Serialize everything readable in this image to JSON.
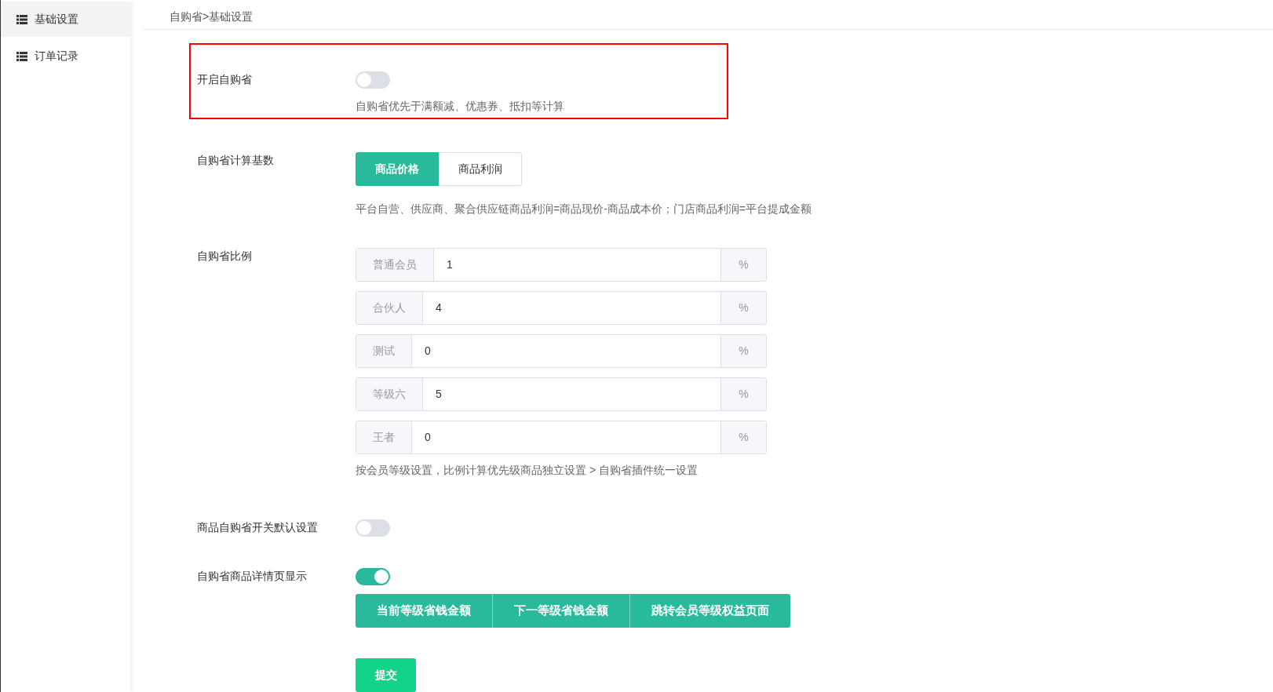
{
  "sidebar": {
    "items": [
      {
        "label": "基础设置",
        "selected": true
      },
      {
        "label": "订单记录",
        "selected": false
      }
    ]
  },
  "breadcrumb": "自购省>基础设置",
  "enable": {
    "label": "开启自购省",
    "on": false,
    "highlighted": true,
    "hint": "自购省优先于满额减、优惠券、抵扣等计算"
  },
  "base": {
    "label": "自购省计算基数",
    "options": [
      {
        "label": "商品价格",
        "selected": true
      },
      {
        "label": "商品利润",
        "selected": false
      }
    ],
    "hint": "平台自营、供应商、聚合供应链商品利润=商品现价-商品成本价；门店商品利润=平台提成金额"
  },
  "ratio": {
    "label": "自购省比例",
    "rows": [
      {
        "level_name": "普通会员",
        "value": "1",
        "unit": "%"
      },
      {
        "level_name": "合伙人",
        "value": "4",
        "unit": "%"
      },
      {
        "level_name": "测试",
        "value": "0",
        "unit": "%"
      },
      {
        "level_name": "等级六",
        "value": "5",
        "unit": "%"
      },
      {
        "level_name": "王者",
        "value": "0",
        "unit": "%"
      }
    ],
    "hint": "按会员等级设置，比例计算优先级商品独立设置 > 自购省插件统一设置"
  },
  "default_switch": {
    "label": "商品自购省开关默认设置",
    "on": false
  },
  "detail_display": {
    "label": "自购省商品详情页显示",
    "on": true,
    "options": [
      {
        "label": "当前等级省钱金额",
        "checked": true
      },
      {
        "label": "下一等级省钱金额",
        "checked": true
      },
      {
        "label": "跳转会员等级权益页面",
        "checked": true
      }
    ]
  },
  "submit": "提交"
}
